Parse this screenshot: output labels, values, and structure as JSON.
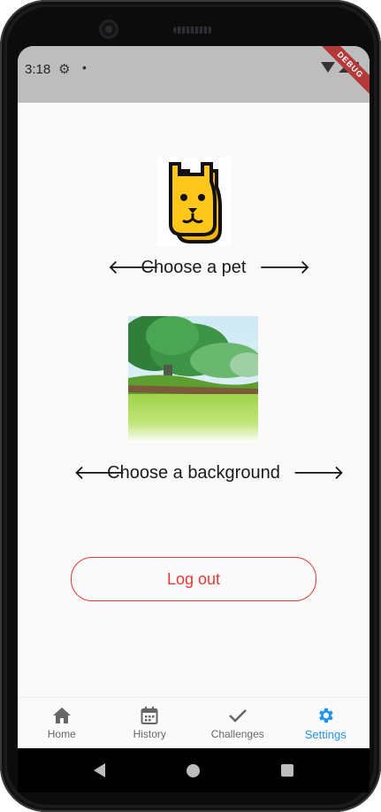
{
  "status_bar": {
    "time": "3:18",
    "debug_banner": "DEBUG"
  },
  "pet_selector": {
    "label": "Choose a pet",
    "prev_icon": "arrow-left-icon",
    "next_icon": "arrow-right-icon",
    "pet_image": "dog-face-icon"
  },
  "background_selector": {
    "label": "Choose a background",
    "prev_icon": "arrow-left-icon",
    "next_icon": "arrow-right-icon",
    "background_image": "forest-meadow"
  },
  "logout_button": {
    "label": "Log out",
    "color": "#e53935"
  },
  "bottom_nav": {
    "active": "Settings",
    "accent_color": "#2196f3",
    "items": [
      {
        "label": "Home",
        "icon": "home-icon"
      },
      {
        "label": "History",
        "icon": "calendar-icon"
      },
      {
        "label": "Challenges",
        "icon": "checkmark-icon"
      },
      {
        "label": "Settings",
        "icon": "gear-icon"
      }
    ]
  }
}
